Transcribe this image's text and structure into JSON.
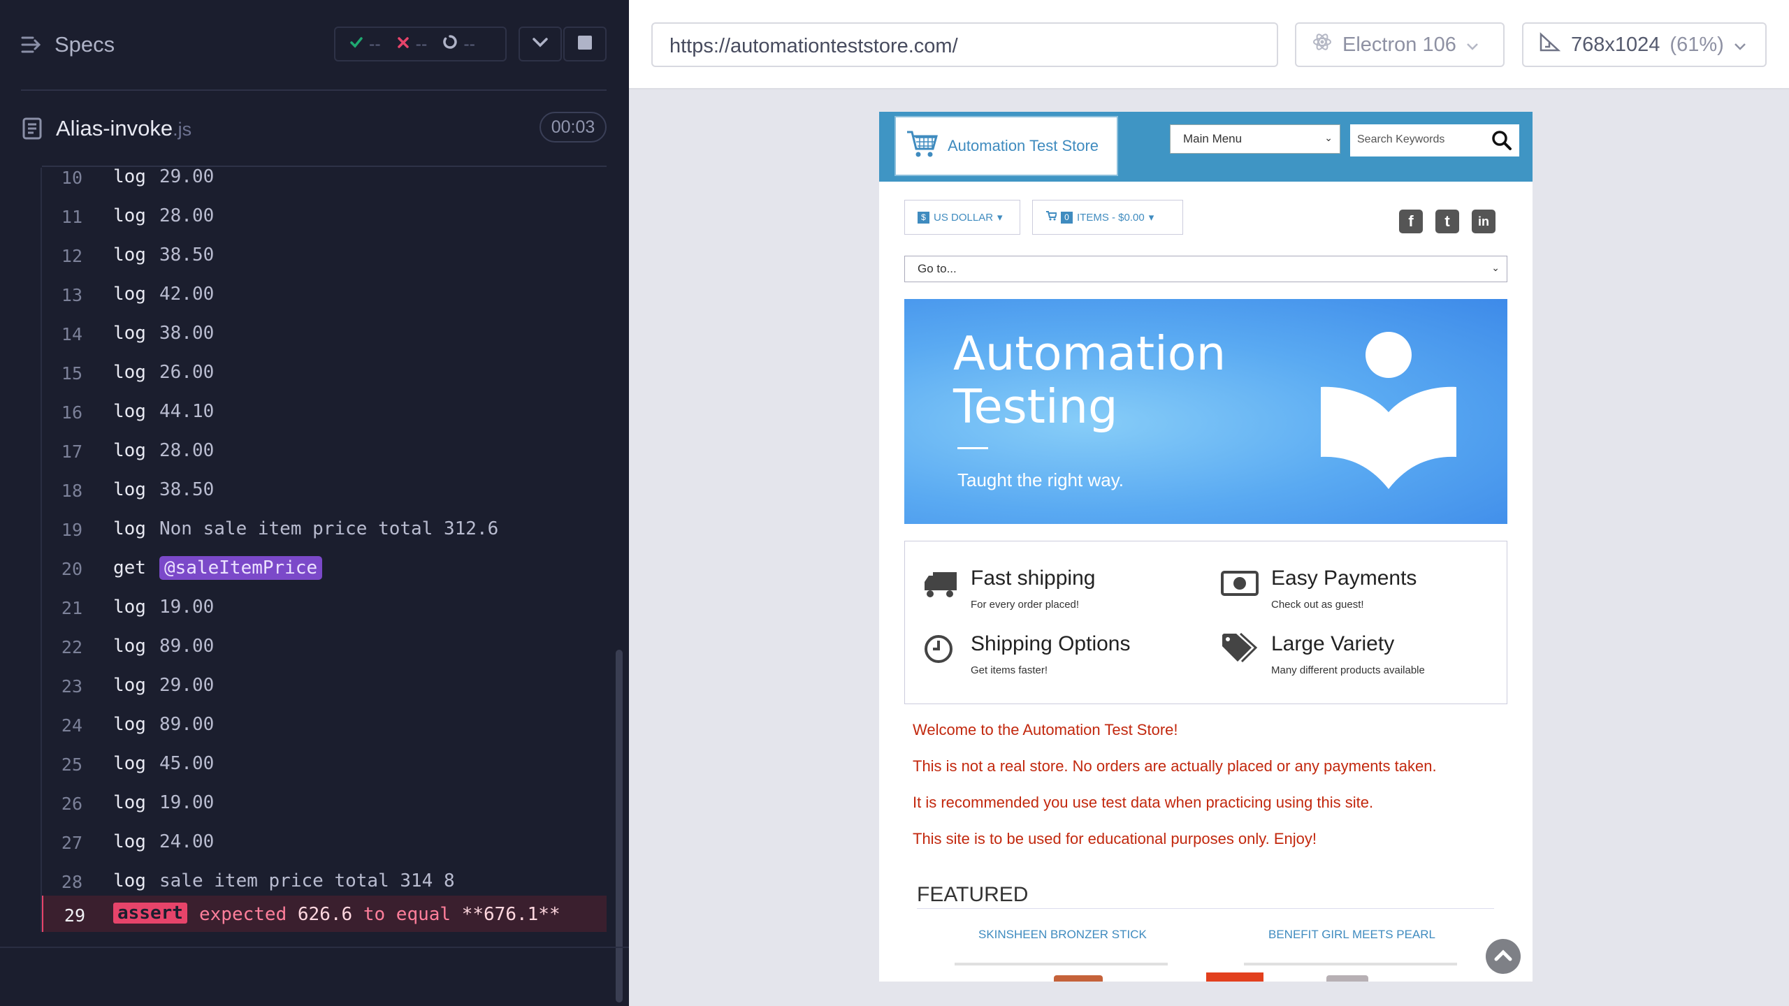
{
  "runner": {
    "specs_label": "Specs",
    "stats": {
      "passed": "--",
      "failed": "--",
      "pending": "--"
    },
    "spec": {
      "name": "Alias-invoke",
      "ext": ".js",
      "duration": "00:03"
    }
  },
  "commands": [
    {
      "num": "10",
      "name": "log",
      "msg": "29.00"
    },
    {
      "num": "11",
      "name": "log",
      "msg": "28.00"
    },
    {
      "num": "12",
      "name": "log",
      "msg": "38.50"
    },
    {
      "num": "13",
      "name": "log",
      "msg": "42.00"
    },
    {
      "num": "14",
      "name": "log",
      "msg": "38.00"
    },
    {
      "num": "15",
      "name": "log",
      "msg": "26.00"
    },
    {
      "num": "16",
      "name": "log",
      "msg": "44.10"
    },
    {
      "num": "17",
      "name": "log",
      "msg": "28.00"
    },
    {
      "num": "18",
      "name": "log",
      "msg": "38.50"
    },
    {
      "num": "19",
      "name": "log",
      "msg": "Non sale item price total 312.6"
    },
    {
      "num": "20",
      "name": "get",
      "msg": "@saleItemPrice",
      "alias": true
    },
    {
      "num": "21",
      "name": "log",
      "msg": "19.00"
    },
    {
      "num": "22",
      "name": "log",
      "msg": "89.00"
    },
    {
      "num": "23",
      "name": "log",
      "msg": "29.00"
    },
    {
      "num": "24",
      "name": "log",
      "msg": "89.00"
    },
    {
      "num": "25",
      "name": "log",
      "msg": "45.00"
    },
    {
      "num": "26",
      "name": "log",
      "msg": "19.00"
    },
    {
      "num": "27",
      "name": "log",
      "msg": "24.00"
    },
    {
      "num": "28",
      "name": "log",
      "msg": "sale item price total 314 8"
    }
  ],
  "failed_command": {
    "num": "29",
    "name": "assert",
    "expected_word": "expected",
    "actual": "626.6",
    "to_equal": "to equal",
    "expected": "**676.1**"
  },
  "aut": {
    "url": "https://automationteststore.com/",
    "browser": "Electron 106",
    "viewport": "768x1024",
    "scale": "(61%)"
  },
  "store": {
    "logo_text": "Automation Test Store",
    "main_menu": "Main Menu",
    "search_placeholder": "Search Keywords",
    "currency_badge": "$",
    "currency": "US DOLLAR",
    "cart_count": "0",
    "cart_text": "ITEMS - $0.00",
    "social": [
      "f",
      "t",
      "in"
    ],
    "goto": "Go to...",
    "hero_line1": "Automation",
    "hero_line2": "Testing",
    "hero_tagline": "Taught the right way.",
    "features": [
      {
        "title": "Fast shipping",
        "sub": "For every order placed!",
        "icon": "truck-icon"
      },
      {
        "title": "Easy Payments",
        "sub": "Check out as guest!",
        "icon": "money-icon"
      },
      {
        "title": "Shipping Options",
        "sub": "Get items faster!",
        "icon": "clock-icon"
      },
      {
        "title": "Large Variety",
        "sub": "Many different products available",
        "icon": "tags-icon"
      }
    ],
    "welcome": [
      "Welcome to the Automation Test Store!",
      "This is not a real store. No orders are actually placed or any payments taken.",
      "It is recommended you use test data when practicing using this site.",
      "This site is to be used for educational purposes only. Enjoy!"
    ],
    "featured_title": "FEATURED",
    "products": [
      "SKINSHEEN BRONZER STICK",
      "BENEFIT GIRL MEETS PEARL"
    ]
  }
}
